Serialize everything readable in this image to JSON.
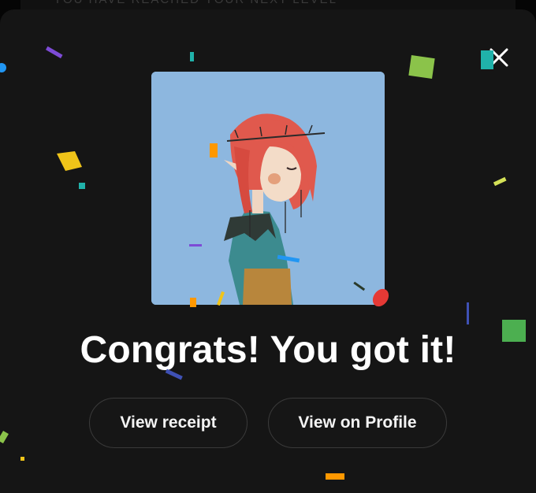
{
  "background": {
    "faded_text": "YOU HAVE REACHED YOUR NEXT LEVEL"
  },
  "modal": {
    "close_icon": "close-icon",
    "image_alt": "red-haired elf character illustration",
    "headline": "Congrats! You got it!",
    "buttons": {
      "receipt_label": "View receipt",
      "profile_label": "View on Profile"
    }
  },
  "colors": {
    "modal_bg": "#151515",
    "image_bg": "#8db7df",
    "confetti": [
      "#7d4bd6",
      "#f0c419",
      "#8bc34a",
      "#20b2aa",
      "#e53935",
      "#ff9800",
      "#2196f3",
      "#4caf50"
    ]
  }
}
